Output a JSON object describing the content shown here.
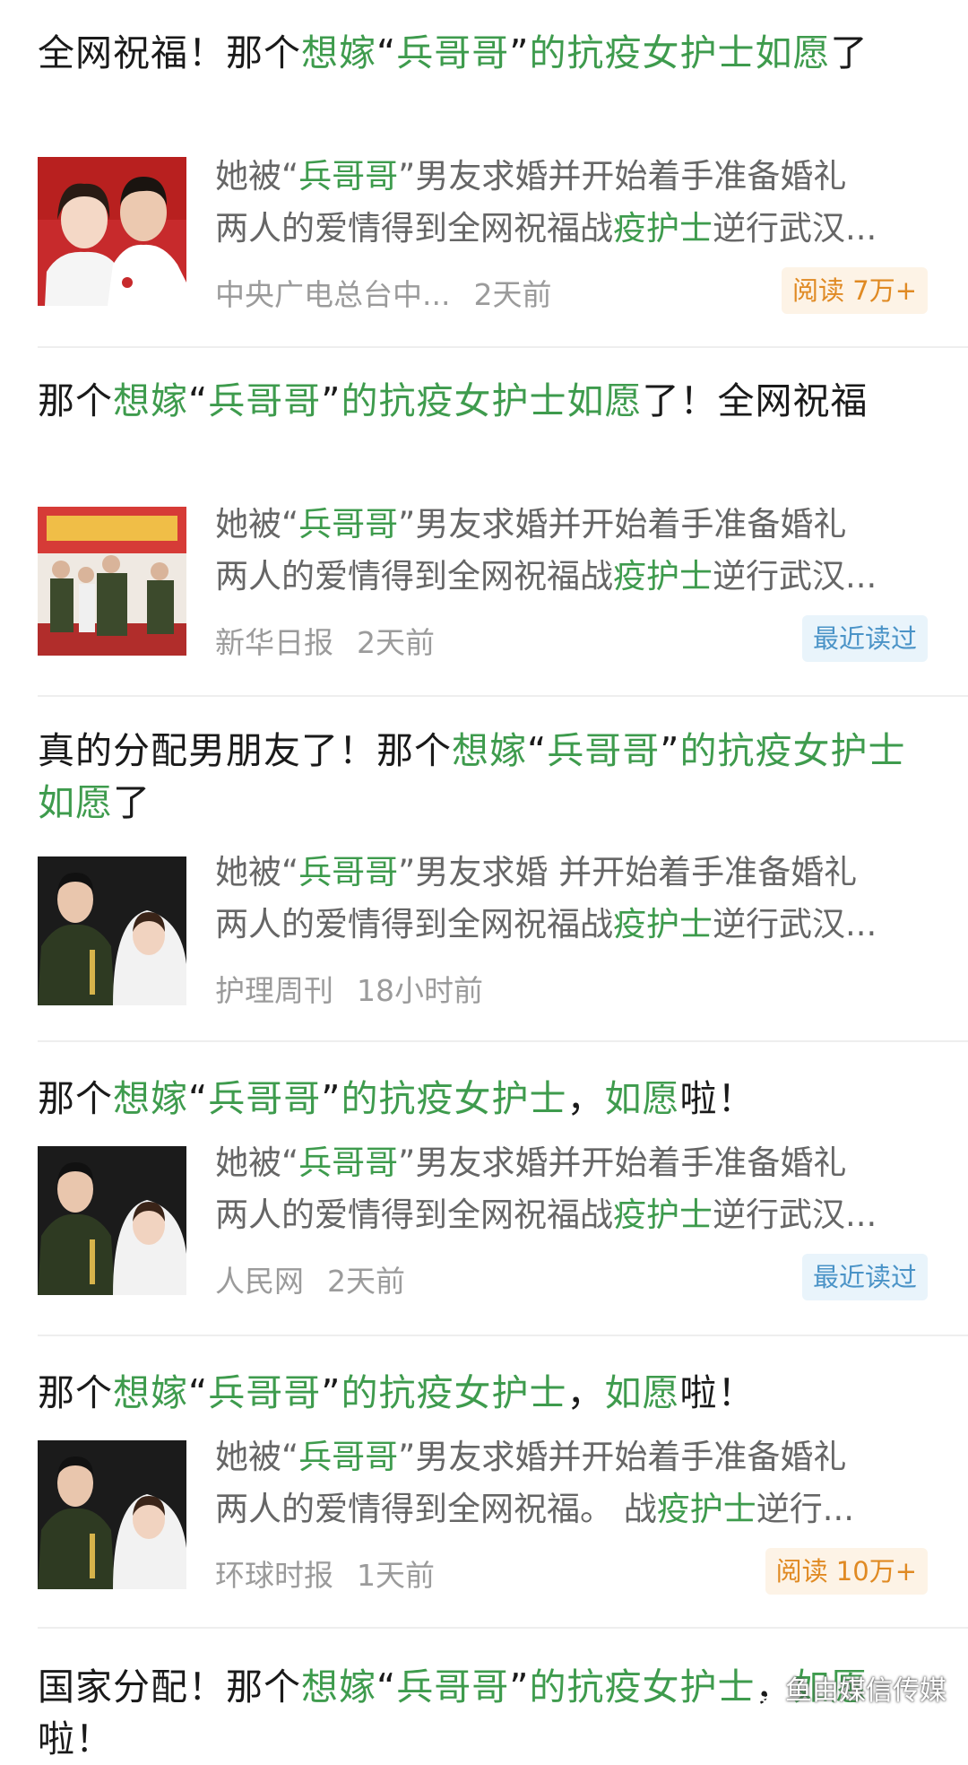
{
  "articles": [
    {
      "title_parts": [
        {
          "t": "全网祝福！那个",
          "hl": false
        },
        {
          "t": "想嫁",
          "hl": true
        },
        {
          "t": "“",
          "hl": false
        },
        {
          "t": "兵哥哥",
          "hl": true
        },
        {
          "t": "”",
          "hl": false
        },
        {
          "t": "的抗疫女护士如愿",
          "hl": true
        },
        {
          "t": "了",
          "hl": false
        }
      ],
      "line1_parts": [
        {
          "t": "她被“",
          "hl": false
        },
        {
          "t": "兵哥哥",
          "hl": true
        },
        {
          "t": "”男友求婚并开始着手准备婚礼",
          "hl": false
        }
      ],
      "line2_parts": [
        {
          "t": "两人的爱情得到全网祝福战",
          "hl": false
        },
        {
          "t": "疫护士",
          "hl": true
        },
        {
          "t": "逆行武汉...",
          "hl": false
        }
      ],
      "source": "中央广电总台中...",
      "time": "2天前",
      "badge": "阅读 7万+",
      "badge_type": "read",
      "image": "couple-portrait-red-background"
    },
    {
      "title_parts": [
        {
          "t": "那个",
          "hl": false
        },
        {
          "t": "想嫁",
          "hl": true
        },
        {
          "t": "“",
          "hl": false
        },
        {
          "t": "兵哥哥",
          "hl": true
        },
        {
          "t": "”",
          "hl": false
        },
        {
          "t": "的抗疫女护士如愿",
          "hl": true
        },
        {
          "t": "了！全网祝福",
          "hl": false
        }
      ],
      "line1_parts": [
        {
          "t": "她被“",
          "hl": false
        },
        {
          "t": "兵哥哥",
          "hl": true
        },
        {
          "t": "”男友求婚并开始着手准备婚礼",
          "hl": false
        }
      ],
      "line2_parts": [
        {
          "t": "两人的爱情得到全网祝福战",
          "hl": false
        },
        {
          "t": "疫护士",
          "hl": true
        },
        {
          "t": "逆行武汉...",
          "hl": false
        }
      ],
      "source": "新华日报",
      "time": "2天前",
      "badge": "最近读过",
      "badge_type": "recent",
      "image": "soldiers-group-photo"
    },
    {
      "title_parts": [
        {
          "t": "真的分配男朋友了！那个",
          "hl": false
        },
        {
          "t": "想嫁",
          "hl": true
        },
        {
          "t": "“",
          "hl": false
        },
        {
          "t": "兵哥哥",
          "hl": true
        },
        {
          "t": "”",
          "hl": false
        },
        {
          "t": "的抗疫女护士如愿",
          "hl": true
        },
        {
          "t": "了",
          "hl": false
        }
      ],
      "line1_parts": [
        {
          "t": "她被“",
          "hl": false
        },
        {
          "t": "兵哥哥",
          "hl": true
        },
        {
          "t": "”男友求婚 并开始着手准备婚礼",
          "hl": false
        }
      ],
      "line2_parts": [
        {
          "t": "两人的爱情得到全网祝福战",
          "hl": false
        },
        {
          "t": "疫护士",
          "hl": true
        },
        {
          "t": "逆行武汉...",
          "hl": false
        }
      ],
      "source": "护理周刊",
      "time": "18小时前",
      "badge": "",
      "badge_type": "",
      "image": "wedding-photo-soldier-bride"
    },
    {
      "title_parts": [
        {
          "t": "那个",
          "hl": false
        },
        {
          "t": "想嫁",
          "hl": true
        },
        {
          "t": "“",
          "hl": false
        },
        {
          "t": "兵哥哥",
          "hl": true
        },
        {
          "t": "”",
          "hl": false
        },
        {
          "t": "的抗疫女护士",
          "hl": true
        },
        {
          "t": "，",
          "hl": false
        },
        {
          "t": "如愿",
          "hl": true
        },
        {
          "t": "啦！",
          "hl": false
        }
      ],
      "line1_parts": [
        {
          "t": "她被“",
          "hl": false
        },
        {
          "t": "兵哥哥",
          "hl": true
        },
        {
          "t": "”男友求婚并开始着手准备婚礼",
          "hl": false
        }
      ],
      "line2_parts": [
        {
          "t": "两人的爱情得到全网祝福战",
          "hl": false
        },
        {
          "t": "疫护士",
          "hl": true
        },
        {
          "t": "逆行武汉...",
          "hl": false
        }
      ],
      "source": "人民网",
      "time": "2天前",
      "badge": "最近读过",
      "badge_type": "recent",
      "image": "wedding-photo-soldier-bride"
    },
    {
      "title_parts": [
        {
          "t": "那个",
          "hl": false
        },
        {
          "t": "想嫁",
          "hl": true
        },
        {
          "t": "“",
          "hl": false
        },
        {
          "t": "兵哥哥",
          "hl": true
        },
        {
          "t": "”",
          "hl": false
        },
        {
          "t": "的抗疫女护士",
          "hl": true
        },
        {
          "t": "，",
          "hl": false
        },
        {
          "t": "如愿",
          "hl": true
        },
        {
          "t": "啦！",
          "hl": false
        }
      ],
      "line1_parts": [
        {
          "t": "她被“",
          "hl": false
        },
        {
          "t": "兵哥哥",
          "hl": true
        },
        {
          "t": "”男友求婚并开始着手准备婚礼",
          "hl": false
        }
      ],
      "line2_parts": [
        {
          "t": "两人的爱情得到全网祝福。 战",
          "hl": false
        },
        {
          "t": "疫护士",
          "hl": true
        },
        {
          "t": "逆行...",
          "hl": false
        }
      ],
      "source": "环球时报",
      "time": "1天前",
      "badge": "阅读 10万+",
      "badge_type": "read",
      "image": "wedding-photo-soldier-bride"
    },
    {
      "title_parts": [
        {
          "t": "国家分配！那个",
          "hl": false
        },
        {
          "t": "想嫁",
          "hl": true
        },
        {
          "t": "“",
          "hl": false
        },
        {
          "t": "兵哥哥",
          "hl": true
        },
        {
          "t": "”",
          "hl": false
        },
        {
          "t": "的抗疫女护士",
          "hl": true
        },
        {
          "t": "，",
          "hl": false
        },
        {
          "t": "如愿",
          "hl": true
        },
        {
          "t": "啦！",
          "hl": false
        }
      ],
      "line1_parts": [],
      "line2_parts": [],
      "source": "",
      "time": "",
      "badge": "",
      "badge_type": "",
      "image": ""
    }
  ],
  "watermark": {
    "text": "鱼由媒信传媒",
    "icon": "wechat-icon"
  },
  "colors": {
    "highlight": "#3e9b4d",
    "read_badge_text": "#e08a23",
    "recent_badge_text": "#4a93c7"
  }
}
